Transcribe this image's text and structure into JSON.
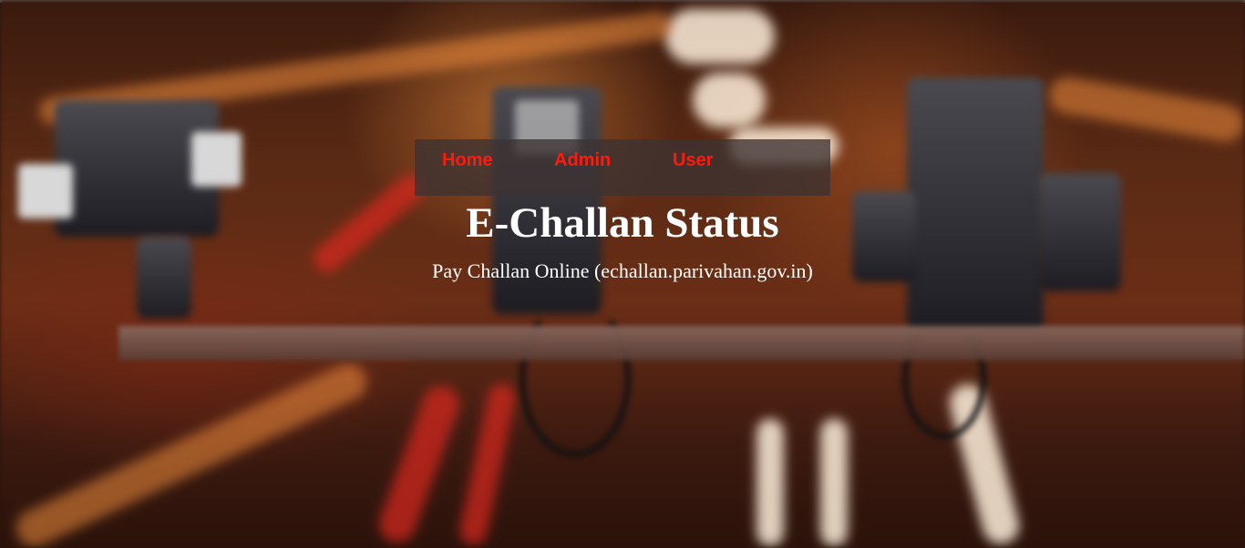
{
  "nav": {
    "items": [
      {
        "label": "Home"
      },
      {
        "label": "Admin"
      },
      {
        "label": "User"
      }
    ]
  },
  "hero": {
    "title": "E-Challan Status",
    "subtitle": "Pay Challan Online (echallan.parivahan.gov.in)"
  },
  "colors": {
    "nav_link": "#ff1a0d",
    "nav_bg": "rgba(60,50,50,0.78)",
    "text": "#ffffff"
  }
}
